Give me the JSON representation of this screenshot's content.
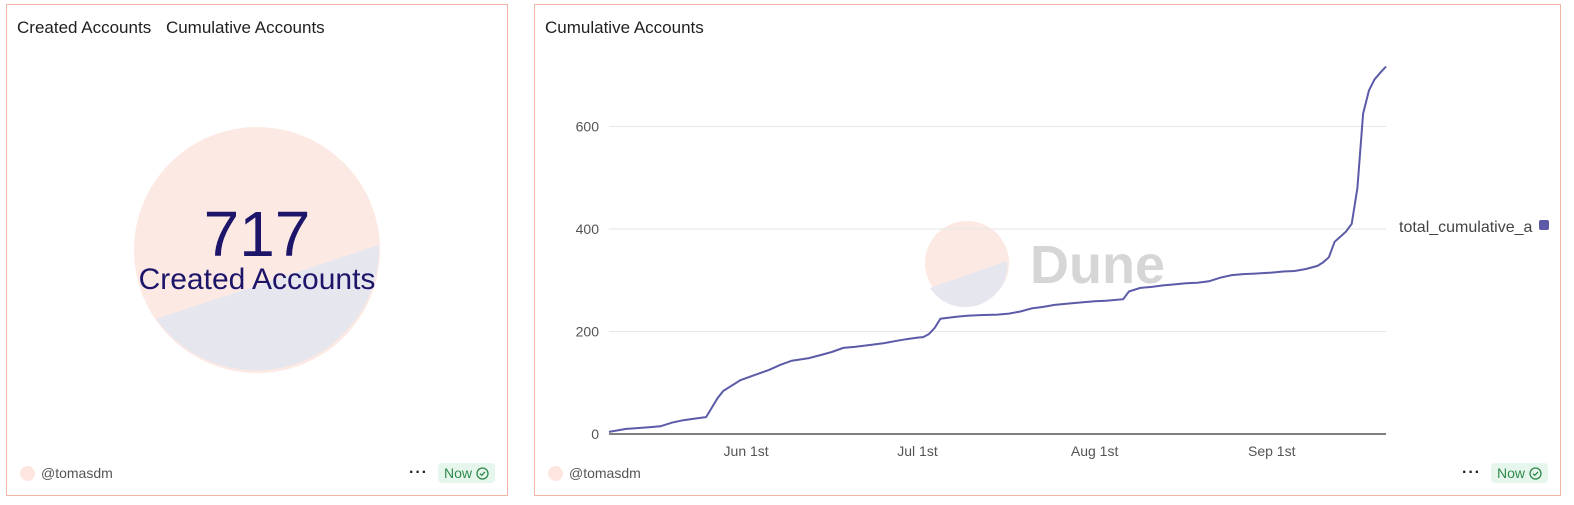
{
  "left_card": {
    "tabs": [
      "Created Accounts",
      "Cumulative Accounts"
    ],
    "counter_value": "717",
    "counter_label": "Created Accounts",
    "author": "@tomasdm",
    "status": "Now"
  },
  "right_card": {
    "title": "Cumulative Accounts",
    "author": "@tomasdm",
    "status": "Now",
    "watermark": "Dune"
  },
  "colors": {
    "accent": "#5b5ba8",
    "border": "#f0b4a6",
    "status_bg": "#e7f6ec",
    "status_fg": "#2f8a4b",
    "counter": "#1c1569"
  },
  "chart_data": {
    "type": "line",
    "title": "Cumulative Accounts",
    "xlabel": "",
    "ylabel": "",
    "x_ticks": [
      {
        "label": "Jun 1st",
        "day": 24
      },
      {
        "label": "Jul 1st",
        "day": 54
      },
      {
        "label": "Aug 1st",
        "day": 85
      },
      {
        "label": "Sep 1st",
        "day": 116
      }
    ],
    "y_ticks": [
      0,
      200,
      400,
      600
    ],
    "ylim": [
      0,
      720
    ],
    "xlim": [
      0,
      132
    ],
    "grid": true,
    "legend": "right",
    "series": [
      {
        "name": "total_cumulative_a",
        "color": "#5b5ba8",
        "points": [
          [
            0,
            4
          ],
          [
            3,
            10
          ],
          [
            7,
            13
          ],
          [
            9,
            15
          ],
          [
            11,
            22
          ],
          [
            13,
            27
          ],
          [
            15,
            30
          ],
          [
            17,
            33
          ],
          [
            19,
            70
          ],
          [
            20,
            84
          ],
          [
            23,
            105
          ],
          [
            25,
            113
          ],
          [
            28,
            125
          ],
          [
            30,
            135
          ],
          [
            32,
            143
          ],
          [
            35,
            148
          ],
          [
            37,
            154
          ],
          [
            39,
            160
          ],
          [
            41,
            168
          ],
          [
            43,
            170
          ],
          [
            46,
            174
          ],
          [
            48,
            177
          ],
          [
            50,
            181
          ],
          [
            52,
            185
          ],
          [
            54,
            188
          ],
          [
            55,
            189
          ],
          [
            56,
            195
          ],
          [
            57,
            207
          ],
          [
            58,
            225
          ],
          [
            61,
            229
          ],
          [
            63,
            231
          ],
          [
            65,
            232
          ],
          [
            68,
            233
          ],
          [
            70,
            235
          ],
          [
            72,
            239
          ],
          [
            74,
            245
          ],
          [
            76,
            248
          ],
          [
            78,
            252
          ],
          [
            81,
            255
          ],
          [
            83,
            257
          ],
          [
            85,
            259
          ],
          [
            87,
            260
          ],
          [
            90,
            263
          ],
          [
            91,
            278
          ],
          [
            93,
            285
          ],
          [
            95,
            287
          ],
          [
            97,
            290
          ],
          [
            99,
            292
          ],
          [
            101,
            294
          ],
          [
            103,
            295
          ],
          [
            105,
            298
          ],
          [
            107,
            305
          ],
          [
            109,
            310
          ],
          [
            111,
            312
          ],
          [
            113,
            313
          ],
          [
            116,
            315
          ],
          [
            118,
            317
          ],
          [
            120,
            318
          ],
          [
            122,
            322
          ],
          [
            124,
            328
          ],
          [
            125,
            335
          ],
          [
            126,
            345
          ],
          [
            127,
            375
          ],
          [
            128,
            385
          ],
          [
            129,
            395
          ],
          [
            130,
            410
          ],
          [
            131,
            480
          ],
          [
            132,
            625
          ],
          [
            133,
            670
          ],
          [
            134,
            692
          ],
          [
            135,
            705
          ],
          [
            136,
            717
          ]
        ]
      }
    ]
  }
}
